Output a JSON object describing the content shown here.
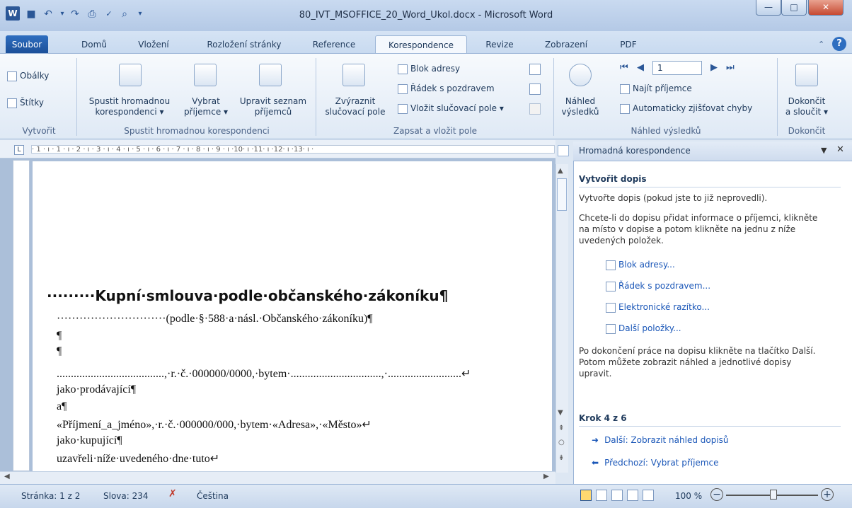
{
  "window": {
    "title": "80_IVT_MSOFFICE_20_Word_Ukol.docx - Microsoft Word"
  },
  "tabs": [
    "Soubor",
    "Domů",
    "Vložení",
    "Rozložení stránky",
    "Reference",
    "Korespondence",
    "Revize",
    "Zobrazení",
    "PDF"
  ],
  "ribbon": {
    "create": {
      "envelopes": "Obálky",
      "labels": "Štítky",
      "group": "Vytvořit"
    },
    "start": {
      "start_line1": "Spustit hromadnou",
      "start_line2": "korespondenci ▾",
      "select_line1": "Vybrat",
      "select_line2": "příjemce ▾",
      "edit_line1": "Upravit seznam",
      "edit_line2": "příjemců",
      "group": "Spustit hromadnou korespondenci"
    },
    "write": {
      "highlight_line1": "Zvýraznit",
      "highlight_line2": "slučovací pole",
      "address_block": "Blok adresy",
      "greeting_line": "Řádek s pozdravem",
      "insert_field": "Vložit slučovací pole ▾",
      "group": "Zapsat a vložit pole"
    },
    "preview": {
      "preview_line1": "Náhled",
      "preview_line2": "výsledků",
      "record": "1",
      "find": "Najít příjemce",
      "auto_check": "Automaticky zjišťovat chyby",
      "group": "Náhled výsledků"
    },
    "finish": {
      "finish_line1": "Dokončit",
      "finish_line2": "a sloučit ▾",
      "group": "Dokončit"
    }
  },
  "ruler": {
    "marks": "· 1 · ı · 1 · ı · 2 · ı · 3 · ı · 4 · ı · 5 · ı · 6 · ı · 7 · ı · 8 · ı · 9 · ı ·10· ı ·11· ı ·12· ı ·13· ı ·"
  },
  "document": {
    "title": "·········Kupní·smlouva·podle·občanského·zákoníku¶",
    "subtitle": "·····························(podle·§·588·a·násl.·Občanského·zákoníku)¶",
    "p1": "¶",
    "p2": "¶",
    "line3": "......................................,·r.·č.·000000/0000,·bytem·................................,·..........................↵",
    "line4": "jako·prodávající¶",
    "line5": "a¶",
    "line6": "«Příjmení_a_jméno»,·r.·č.·000000/000,·bytem·«Adresa»,·«Město»↵",
    "line7": "jako·kupující¶",
    "line8": "uzavřeli·níže·uvedeného·dne·tuto↵"
  },
  "pane": {
    "title": "Hromadná korespondence",
    "heading": "Vytvořit dopis",
    "intro": "Vytvořte dopis (pokud jste to již neprovedli).",
    "info_1": "Chcete-li do dopisu přidat informace o příjemci, klikněte",
    "info_2": "na místo v dopise a potom klikněte na jednu z níže",
    "info_3": "uvedených položek.",
    "links": [
      "Blok adresy...",
      "Řádek s pozdravem...",
      "Elektronické razítko...",
      "Další položky..."
    ],
    "finish_1": "Po dokončení práce na dopisu klikněte na tlačítko Další.",
    "finish_2": "Potom můžete zobrazit náhled a jednotlivé dopisy",
    "finish_3": "upravit.",
    "step": "Krok 4 z 6",
    "next": "Další: Zobrazit náhled dopisů",
    "prev": "Předchozí: Vybrat příjemce"
  },
  "status": {
    "page": "Stránka: 1 z 2",
    "words": "Slova: 234",
    "language": "Čeština",
    "zoom": "100 %"
  }
}
